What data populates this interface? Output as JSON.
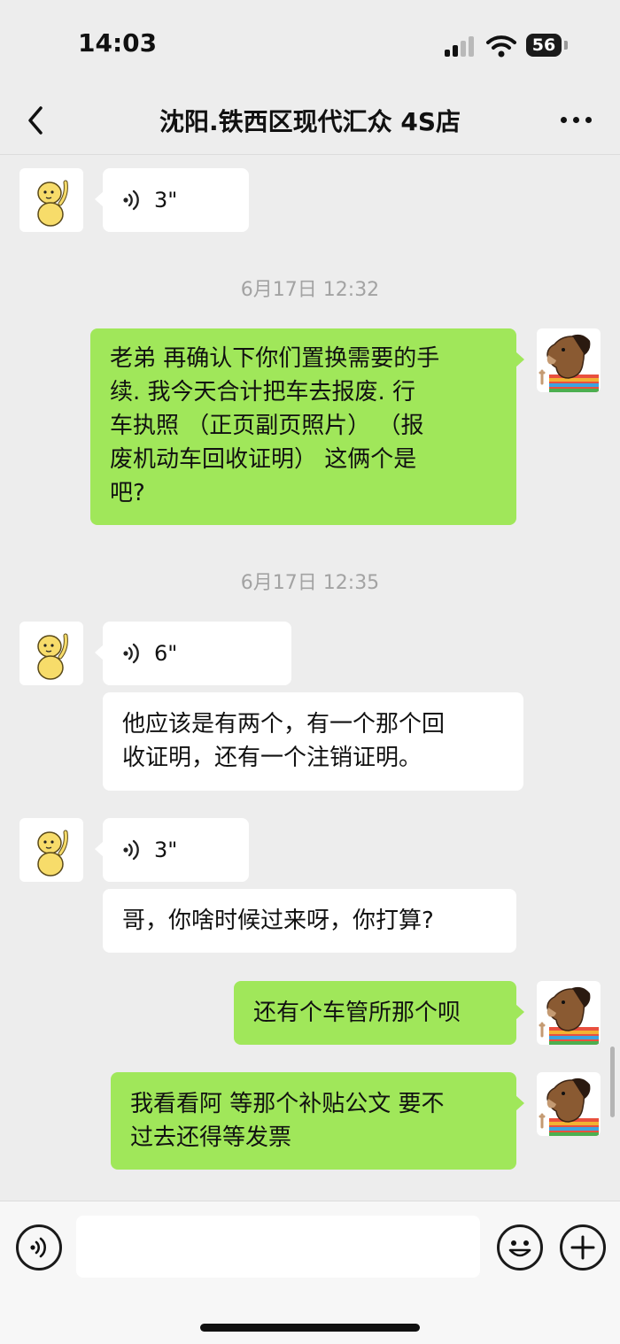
{
  "status": {
    "time": "14:03",
    "battery": "56"
  },
  "nav": {
    "title": "沈阳.铁西区现代汇众 4S店"
  },
  "messages": {
    "m1": {
      "duration": "3\""
    },
    "ts1": "6月17日 12:32",
    "m2": {
      "lines": [
        "老弟 再确认下你们置换需要的手",
        "续. 我今天合计把车去报废.  行",
        "车执照 （正页副页照片） （报",
        "废机动车回收证明） 这俩个是",
        "吧?"
      ]
    },
    "ts2": "6月17日 12:35",
    "m3": {
      "duration": "6\""
    },
    "m4": {
      "lines": [
        "他应该是有两个，有一个那个回",
        "收证明，还有一个注销证明。"
      ]
    },
    "m5": {
      "duration": "3\""
    },
    "m6": {
      "text": "哥，你啥时候过来呀，你打算?"
    },
    "m7": {
      "text": "还有个车管所那个呗"
    },
    "m8": {
      "lines": [
        "我看看阿 等那个补贴公文 要不",
        "过去还得等发票"
      ]
    }
  },
  "input": {
    "placeholder": ""
  },
  "colors": {
    "bubble_self": "#a0e75a",
    "bubble_other": "#ffffff",
    "background": "#ededed"
  },
  "icons": {
    "back": "chevron-left-icon",
    "more": "more-dots-icon",
    "voice_toggle": "voice-mode-icon",
    "emoji": "emoji-icon",
    "plus": "plus-icon",
    "shop_avatar": "yellow-figure-avatar",
    "self_avatar": "horse-avatar"
  }
}
